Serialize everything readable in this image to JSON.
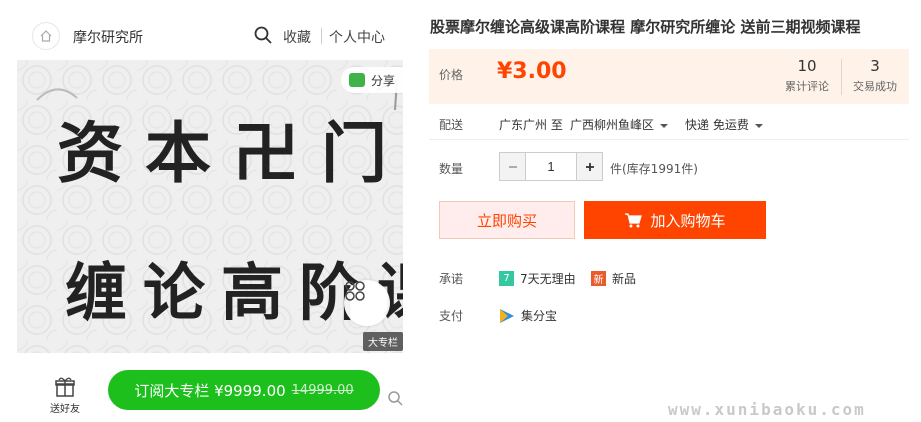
{
  "header": {
    "shop_name": "摩尔研究所",
    "favorite_label": "收藏",
    "user_center_label": "个人中心"
  },
  "cover": {
    "line1": "资本卍门",
    "line2": "缠论高阶课",
    "share_label": "分享",
    "badge": "大专栏"
  },
  "footer": {
    "gift_label": "送好友",
    "subscribe_label": "订阅大专栏 ¥9999.00",
    "subscribe_old_price": "14999.00"
  },
  "product": {
    "title": "股票摩尔缠论高级课高阶课程 摩尔研究所缠论 送前三期视频课程",
    "price_label": "价格",
    "price": "¥3.00",
    "reviews_count": "10",
    "reviews_label": "累计评论",
    "trades_count": "3",
    "trades_label": "交易成功"
  },
  "shipping": {
    "label": "配送",
    "from": "广东广州 至",
    "to": "广西柳州鱼峰区",
    "method": "快递 免运费"
  },
  "quantity": {
    "label": "数量",
    "value": "1",
    "stock": "件(库存1991件)"
  },
  "actions": {
    "buy_now": "立即购买",
    "add_to_cart": "加入购物车"
  },
  "promise": {
    "label": "承诺",
    "items": [
      "7天无理由",
      "新品"
    ]
  },
  "payment": {
    "label": "支付",
    "method": "集分宝"
  },
  "watermark": "www.xunibaoku.com",
  "colors": {
    "accent": "#ff4400",
    "price_bg": "#fff2e8",
    "subscribe_green": "#1cbf1c"
  }
}
